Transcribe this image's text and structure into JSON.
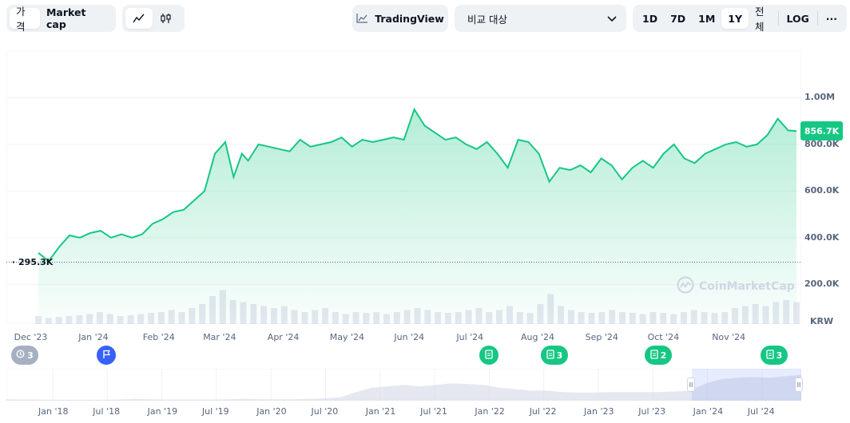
{
  "toolbar": {
    "metric_tabs": [
      {
        "label": "가격",
        "active": true
      },
      {
        "label": "Market cap",
        "active": false
      }
    ],
    "chart_type_icons": [
      "line-chart-icon",
      "candlestick-icon"
    ],
    "tradingview_label": "TradingView",
    "compare_placeholder": "비교 대상",
    "ranges": [
      {
        "label": "1D"
      },
      {
        "label": "7D"
      },
      {
        "label": "1M"
      },
      {
        "label": "1Y",
        "active": true
      },
      {
        "label": "전체"
      }
    ],
    "log_label": "LOG",
    "more_label": "···"
  },
  "current_price_label": "856.7K",
  "start_price_label": "295.3K",
  "currency_label": "KRW",
  "watermark": "CoinMarketCap",
  "colors": {
    "line": "#16c784",
    "accent_blue": "#3861fb",
    "gray_marker": "#a6b0c3"
  },
  "markers": [
    {
      "type": "history",
      "count": "3",
      "color": "#a6b0c3"
    },
    {
      "type": "flag",
      "count": "",
      "color": "#3861fb"
    },
    {
      "type": "document",
      "count": "",
      "color": "#16c784"
    },
    {
      "type": "document",
      "count": "3",
      "color": "#16c784"
    },
    {
      "type": "document",
      "count": "2",
      "color": "#16c784"
    },
    {
      "type": "document",
      "count": "3",
      "color": "#16c784"
    }
  ],
  "chart_data": {
    "type": "area",
    "y_ticks": [
      "200.0K",
      "400.0K",
      "600.0K",
      "800.0K",
      "1.00M"
    ],
    "x_ticks": [
      "Dec '23",
      "Jan '24",
      "Feb '24",
      "Mar '24",
      "Apr '24",
      "May '24",
      "Jun '24",
      "Jul '24",
      "Aug '24",
      "Sep '24",
      "Oct '24",
      "Nov '24"
    ],
    "ylim": [
      30000,
      1200000
    ],
    "grid": true,
    "series": [
      {
        "x": [
          "2023-12-05",
          "2023-12-10",
          "2023-12-15",
          "2023-12-20",
          "2023-12-25",
          "2023-12-30",
          "2024-01-04",
          "2024-01-09",
          "2024-01-14",
          "2024-01-19",
          "2024-01-24",
          "2024-01-29",
          "2024-02-03",
          "2024-02-08",
          "2024-02-13",
          "2024-02-18",
          "2024-02-23",
          "2024-02-28",
          "2024-03-04",
          "2024-03-08",
          "2024-03-12",
          "2024-03-15",
          "2024-03-20",
          "2024-03-25",
          "2024-03-30",
          "2024-04-04",
          "2024-04-09",
          "2024-04-14",
          "2024-04-19",
          "2024-04-24",
          "2024-04-29",
          "2024-05-04",
          "2024-05-09",
          "2024-05-14",
          "2024-05-19",
          "2024-05-24",
          "2024-05-29",
          "2024-06-03",
          "2024-06-08",
          "2024-06-13",
          "2024-06-18",
          "2024-06-23",
          "2024-06-28",
          "2024-07-03",
          "2024-07-08",
          "2024-07-13",
          "2024-07-18",
          "2024-07-23",
          "2024-07-28",
          "2024-08-02",
          "2024-08-07",
          "2024-08-12",
          "2024-08-17",
          "2024-08-22",
          "2024-08-27",
          "2024-09-01",
          "2024-09-06",
          "2024-09-11",
          "2024-09-16",
          "2024-09-21",
          "2024-09-26",
          "2024-10-01",
          "2024-10-06",
          "2024-10-11",
          "2024-10-16",
          "2024-10-21",
          "2024-10-26",
          "2024-10-31",
          "2024-11-05",
          "2024-11-10",
          "2024-11-15",
          "2024-11-20",
          "2024-11-25",
          "2024-11-30",
          "2024-12-04"
        ],
        "values": [
          335000,
          300000,
          360000,
          410000,
          400000,
          420000,
          430000,
          400000,
          415000,
          400000,
          415000,
          460000,
          480000,
          510000,
          520000,
          560000,
          600000,
          760000,
          810000,
          660000,
          760000,
          730000,
          800000,
          790000,
          780000,
          770000,
          820000,
          790000,
          800000,
          810000,
          830000,
          790000,
          820000,
          810000,
          820000,
          830000,
          820000,
          950000,
          880000,
          850000,
          820000,
          830000,
          800000,
          780000,
          810000,
          760000,
          700000,
          820000,
          810000,
          760000,
          640000,
          700000,
          690000,
          710000,
          680000,
          740000,
          710000,
          650000,
          700000,
          730000,
          700000,
          760000,
          800000,
          740000,
          720000,
          760000,
          780000,
          800000,
          810000,
          790000,
          800000,
          840000,
          910000,
          860000,
          856700
        ]
      }
    ],
    "volume_relative": [
      0.2,
      0.15,
      0.18,
      0.2,
      0.22,
      0.25,
      0.3,
      0.25,
      0.2,
      0.22,
      0.25,
      0.28,
      0.3,
      0.35,
      0.3,
      0.4,
      0.5,
      0.7,
      0.85,
      0.6,
      0.55,
      0.5,
      0.45,
      0.4,
      0.45,
      0.35,
      0.3,
      0.35,
      0.4,
      0.3,
      0.25,
      0.3,
      0.28,
      0.3,
      0.25,
      0.3,
      0.35,
      0.4,
      0.35,
      0.3,
      0.28,
      0.3,
      0.35,
      0.4,
      0.3,
      0.35,
      0.45,
      0.3,
      0.28,
      0.5,
      0.75,
      0.45,
      0.35,
      0.3,
      0.28,
      0.3,
      0.35,
      0.3,
      0.28,
      0.25,
      0.3,
      0.28,
      0.25,
      0.3,
      0.35,
      0.3,
      0.28,
      0.3,
      0.4,
      0.45,
      0.5,
      0.45,
      0.55,
      0.6,
      0.55
    ]
  },
  "navigator": {
    "x_ticks": [
      "Jan '18",
      "Jul '18",
      "Jan '19",
      "Jul '19",
      "Jan '20",
      "Jul '20",
      "Jan '21",
      "Jul '21",
      "Jan '22",
      "Jul '22",
      "Jan '23",
      "Jul '23",
      "Jan '24",
      "Jul '24"
    ],
    "values": [
      0.05,
      0.04,
      0.04,
      0.03,
      0.03,
      0.03,
      0.03,
      0.04,
      0.06,
      0.05,
      0.04,
      0.04,
      0.04,
      0.04,
      0.05,
      0.06,
      0.05,
      0.05,
      0.05,
      0.06,
      0.08,
      0.12,
      0.3,
      0.45,
      0.5,
      0.55,
      0.5,
      0.55,
      0.6,
      0.58,
      0.55,
      0.45,
      0.4,
      0.35,
      0.35,
      0.3,
      0.28,
      0.28,
      0.3,
      0.3,
      0.3,
      0.3,
      0.32,
      0.35,
      0.6,
      0.75,
      0.8,
      0.82,
      0.8,
      0.85,
      0.9
    ],
    "handle_label": "II"
  }
}
